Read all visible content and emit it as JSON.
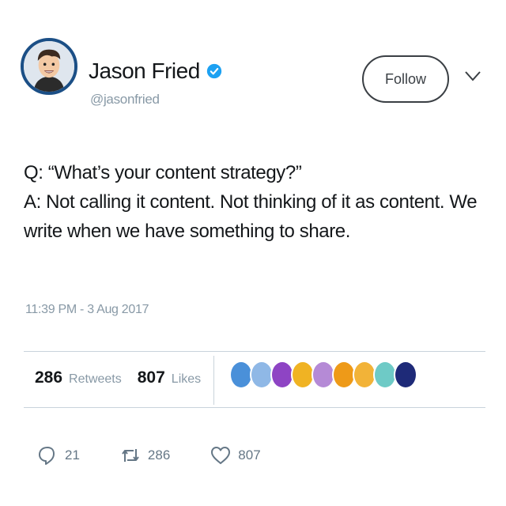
{
  "author": {
    "display_name": "Jason Fried",
    "handle": "@jasonfried",
    "verified": true,
    "avatar_icon": "cartoon-avatar"
  },
  "header": {
    "follow_label": "Follow",
    "menu_icon": "chevron-down-icon"
  },
  "tweet": {
    "lines": [
      "Q: “What’s your content strategy?”",
      "A: Not calling it content. Not thinking of it as content. We write when we have something to share."
    ],
    "timestamp": "11:39 PM - 3 Aug 2017"
  },
  "stats": {
    "retweets_count": "286",
    "retweets_label": "Retweets",
    "likes_count": "807",
    "likes_label": "Likes",
    "liker_colors": [
      "#4a90d9",
      "#8fb8e6",
      "#8e44c4",
      "#f0b323",
      "#b58ad6",
      "#ee9a18",
      "#f2b338",
      "#6ecac6",
      "#1e2a78"
    ]
  },
  "actions": {
    "replies": "21",
    "retweets": "286",
    "likes": "807"
  },
  "colors": {
    "verified": "#1da1f2",
    "muted_text": "#8899a6",
    "avatar_ring": "#1b4f86"
  }
}
